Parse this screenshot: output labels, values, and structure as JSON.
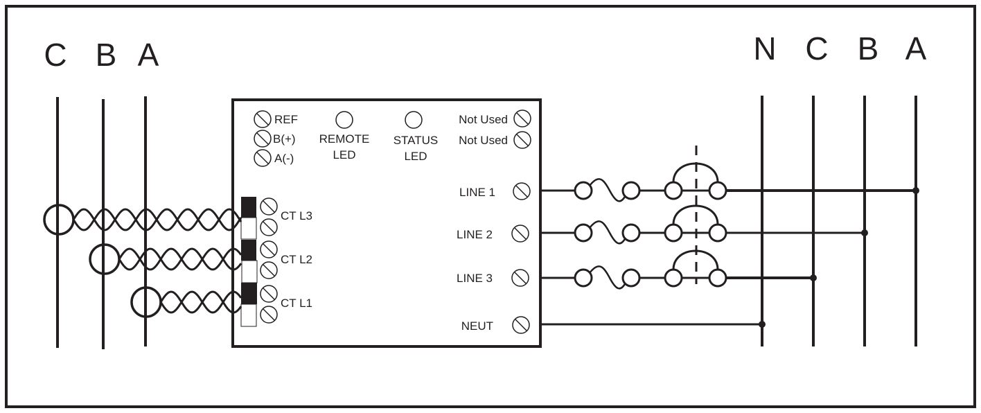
{
  "diagram": {
    "left_bus": {
      "labels": [
        "C",
        "B",
        "A"
      ]
    },
    "right_bus": {
      "labels": [
        "N",
        "C",
        "B",
        "A"
      ]
    },
    "meter": {
      "comm_terminals": [
        "REF",
        "B(+)",
        "A(-)"
      ],
      "remote_led": {
        "line1": "REMOTE",
        "line2": "LED"
      },
      "status_led": {
        "line1": "STATUS",
        "line2": "LED"
      },
      "unused_terminals": [
        "Not Used",
        "Not Used"
      ],
      "ct_inputs": [
        "CT L3",
        "CT L2",
        "CT L1"
      ],
      "voltage_inputs": [
        "LINE 1",
        "LINE 2",
        "LINE 3",
        "NEUT"
      ]
    },
    "colors": {
      "ink": "#231f20",
      "background": "#ffffff"
    }
  }
}
